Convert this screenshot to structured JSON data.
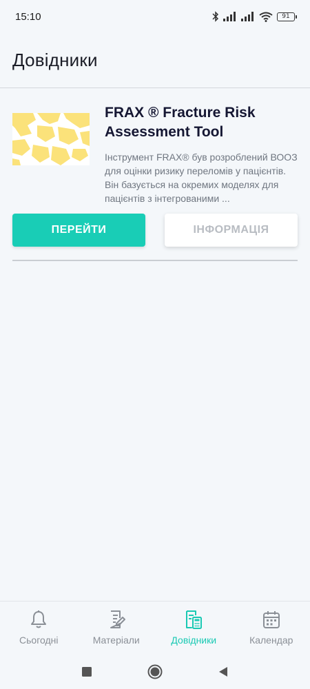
{
  "status_bar": {
    "time": "15:10",
    "battery": "91"
  },
  "header": {
    "title": "Довідники"
  },
  "card": {
    "title": "FRAX ® Fracture Risk Assessment Tool",
    "description": "Інструмент FRAX® був розроблений ВООЗ для оцінки ризику переломів у пацієнтів. Він базується на окремих моделях для пацієнтів з інтегрованими ...",
    "go_label": "ПЕРЕЙТИ",
    "info_label": "ІНФОРМАЦІЯ"
  },
  "bottom_nav": {
    "items": [
      {
        "label": "Сьогодні",
        "icon": "bell-icon"
      },
      {
        "label": "Матеріали",
        "icon": "document-edit-icon"
      },
      {
        "label": "Довідники",
        "icon": "reference-calculator-icon",
        "active": true
      },
      {
        "label": "Календар",
        "icon": "calendar-icon"
      }
    ]
  },
  "colors": {
    "accent": "#19cdb6",
    "background": "#f4f7fa",
    "thumb_yellow": "#fbe27a"
  }
}
